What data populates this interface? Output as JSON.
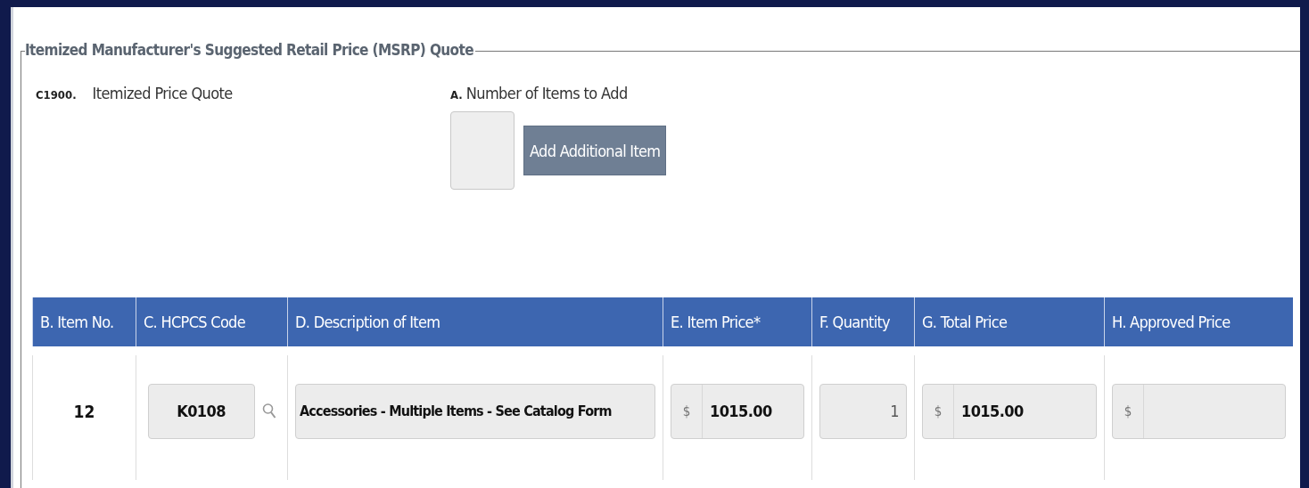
{
  "fieldset": {
    "legend": "Itemized Manufacturer's Suggested Retail Price (MSRP) Quote"
  },
  "question": {
    "code": "C1900.",
    "label": "Itemized Price Quote"
  },
  "add_items": {
    "letter": "A.",
    "label": "Number of Items to Add",
    "button": "Add Additional Item"
  },
  "table": {
    "columns": [
      "B. Item No.",
      "C. HCPCS Code",
      "D. Description of Item",
      "E. Item Price*",
      "F. Quantity",
      "G. Total Price",
      "H. Approved Price"
    ],
    "rows": [
      {
        "cells": [
          {
            "kind": "plain",
            "value": "12"
          },
          {
            "kind": "lookup",
            "value": "K0108"
          },
          {
            "kind": "field",
            "value": "Accessories - Multiple Items - See Catalog Form"
          },
          {
            "kind": "currency",
            "symbol": "$",
            "value": "1015.00"
          },
          {
            "kind": "number",
            "value": "1"
          },
          {
            "kind": "currency",
            "symbol": "$",
            "value": "1015.00"
          },
          {
            "kind": "currency",
            "symbol": "$"
          }
        ]
      }
    ]
  }
}
